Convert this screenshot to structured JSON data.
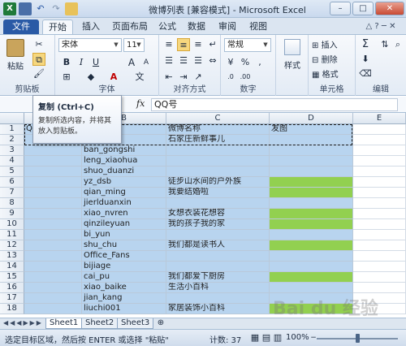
{
  "window": {
    "title": "微博列表 [兼容模式] - Microsoft Excel"
  },
  "tabs": [
    {
      "label": "文件"
    },
    {
      "label": "开始"
    },
    {
      "label": "插入"
    },
    {
      "label": "页面布局"
    },
    {
      "label": "公式"
    },
    {
      "label": "数据"
    },
    {
      "label": "审阅"
    },
    {
      "label": "视图"
    }
  ],
  "ribbon": {
    "clipboard": {
      "paste": "粘贴",
      "label": "剪贴板"
    },
    "font": {
      "name": "宋体",
      "size": "11",
      "bold": "B",
      "italic": "I",
      "underline": "U",
      "grow": "A",
      "shrink": "A",
      "label": "字体"
    },
    "alignment": {
      "label": "对齐方式"
    },
    "number": {
      "format": "常规",
      "percent": "%",
      "comma": ",",
      "label": "数字"
    },
    "styles": {
      "styles": "样式",
      "label": ""
    },
    "cells": {
      "insert": "插入",
      "delete": "删除",
      "format": "格式",
      "label": "单元格"
    },
    "editing": {
      "sum": "Σ",
      "label": "编辑"
    }
  },
  "tooltip": {
    "title": "复制 (Ctrl+C)",
    "description": "复制所选内容，并将其放入剪贴板。"
  },
  "formula_bar": {
    "fx": "fx",
    "value": "QQ号"
  },
  "grid": {
    "columns": [
      "A",
      "B",
      "C",
      "D",
      "E"
    ],
    "rows": [
      {
        "num": "1",
        "a": "QQ",
        "b": "",
        "c": "微博名称",
        "d": "发图",
        "d_green": false
      },
      {
        "num": "2",
        "a": "",
        "b": "huang",
        "c": "石家庄新鲜事儿",
        "d": "",
        "d_green": false
      },
      {
        "num": "3",
        "a": "",
        "b": "ban_gongshi",
        "c": "",
        "d": "",
        "d_green": false
      },
      {
        "num": "4",
        "a": "",
        "b": "leng_xiaohua",
        "c": "",
        "d": "",
        "d_green": false
      },
      {
        "num": "5",
        "a": "",
        "b": "shuo_duanzi",
        "c": "",
        "d": "",
        "d_green": false
      },
      {
        "num": "6",
        "a": "",
        "b": "yz_dsb",
        "c": "徒步山水间的户外族",
        "d": "",
        "d_green": true
      },
      {
        "num": "7",
        "a": "",
        "b": "qian_ming",
        "c": "我要结婚啦",
        "d": "",
        "d_green": true
      },
      {
        "num": "8",
        "a": "",
        "b": "jierlduanxin",
        "c": "",
        "d": "",
        "d_green": false
      },
      {
        "num": "9",
        "a": "",
        "b": "xiao_nvren",
        "c": "女想衣装花想容",
        "d": "",
        "d_green": true
      },
      {
        "num": "10",
        "a": "",
        "b": "qinzileyuan",
        "c": "我的孩子我的家",
        "d": "",
        "d_green": true
      },
      {
        "num": "11",
        "a": "",
        "b": "bi_yun",
        "c": "",
        "d": "",
        "d_green": false
      },
      {
        "num": "12",
        "a": "",
        "b": "shu_chu",
        "c": "我们都是读书人",
        "d": "",
        "d_green": true
      },
      {
        "num": "13",
        "a": "",
        "b": "Office_Fans",
        "c": "",
        "d": "",
        "d_green": false
      },
      {
        "num": "14",
        "a": "",
        "b": "bijiage",
        "c": "",
        "d": "",
        "d_green": false
      },
      {
        "num": "15",
        "a": "",
        "b": "cai_pu",
        "c": "我们都爱下厨房",
        "d": "",
        "d_green": true
      },
      {
        "num": "16",
        "a": "",
        "b": "xiao_baike",
        "c": "生活小百科",
        "d": "",
        "d_green": false
      },
      {
        "num": "17",
        "a": "",
        "b": "jian_kang",
        "c": "",
        "d": "",
        "d_green": false
      },
      {
        "num": "18",
        "a": "",
        "b": "liuchi001",
        "c": "家居装饰小百科",
        "d": "",
        "d_green": true
      }
    ]
  },
  "sheets": [
    {
      "label": "Sheet1"
    },
    {
      "label": "Sheet2"
    },
    {
      "label": "Sheet3"
    }
  ],
  "status": {
    "message": "选定目标区域，然后按 ENTER 或选择 \"粘贴\"",
    "count": "计数: 37",
    "zoom": "100%"
  },
  "watermark": "Bai du 经验"
}
